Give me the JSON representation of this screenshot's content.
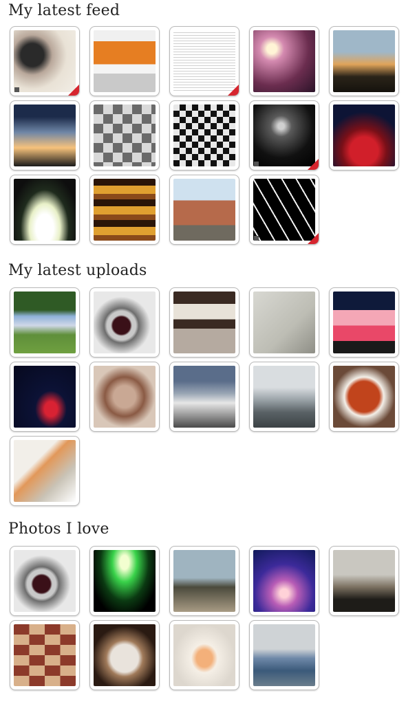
{
  "sections": [
    {
      "title": "My latest feed",
      "photos": [
        {
          "name": "feed-photo-woman-portrait",
          "bg": "radial-gradient(circle at 30% 40%, #2a2a2a 0 20%, #b9a89b 35%, #e9e2d6 60%, #f2eee6 100%)",
          "corner": true,
          "who": true
        },
        {
          "name": "feed-photo-instagram-website",
          "bg": "linear-gradient(180deg,#f0f0f0 0 18%, #e67e22 18% 55%, #f4f4f4 55% 70%, #c9c9c9 70% 100%)",
          "corner": false,
          "who": false
        },
        {
          "name": "feed-photo-article-text",
          "bg": "repeating-linear-gradient(180deg,#ffffff 0 3px,#cfcfcf 3px 4px)",
          "corner": true,
          "who": false
        },
        {
          "name": "feed-photo-sun-through-tree",
          "bg": "radial-gradient(circle at 30% 30%, #fff4d6 0 8%, #d48ab0 20%, #6b2d4f 60%, #2a1328 100%)",
          "corner": false,
          "who": false
        },
        {
          "name": "feed-photo-sunset-trees",
          "bg": "linear-gradient(180deg,#9fb7c8 0 35%, #e0a45a 55%, #2b2419 75%, #15120d 100%)",
          "corner": false,
          "who": false
        },
        {
          "name": "feed-photo-forest-sunset",
          "bg": "linear-gradient(180deg,#1c2b4a 0 20%, #6f86a6 45%, #f6c27b 70%, #1a1a1a 100%)",
          "corner": false,
          "who": false
        },
        {
          "name": "feed-photo-bw-collage",
          "bg": "repeating-conic-gradient(#d9d9d9 0 25%, #6a6a6a 0 50%) 0 0/28px 28px",
          "corner": false,
          "who": false
        },
        {
          "name": "feed-photo-mosaic-grid",
          "bg": "repeating-conic-gradient(#111 0 25%, #e8e8e8 0 50%) 0 0/18px 18px",
          "corner": false,
          "who": false
        },
        {
          "name": "feed-photo-dark-alley",
          "bg": "radial-gradient(circle at 45% 35%, #d0d0d0 0 6%, #5a5a5a 20%, #111 60%, #000 100%)",
          "corner": true,
          "who": true
        },
        {
          "name": "feed-photo-red-chair",
          "bg": "radial-gradient(circle at 50% 75%, #d11f2a 0 25%, #7a1018 40%, #0d1435 70%)",
          "corner": false,
          "who": false
        },
        {
          "name": "feed-photo-umbrella-silhouette",
          "bg": "radial-gradient(ellipse at 50% 80%, #ffffff 0 20%, #e8f0c8 35%, #1f2b1d 55%, #0e0e0e 80%)",
          "corner": false,
          "who": false
        },
        {
          "name": "feed-photo-sandwich-stack",
          "bg": "repeating-linear-gradient(180deg,#2a1508 0 10px,#e0a030 10px 22px,#8a4a1a 22px 30px)",
          "corner": false,
          "who": false
        },
        {
          "name": "feed-photo-ruins-tower",
          "bg": "linear-gradient(180deg,#cfe1ef 0 35%, #b66a4b 35% 75%, #6f6a5f 75% 100%)",
          "corner": false,
          "who": false
        },
        {
          "name": "feed-photo-firework-streaks",
          "bg": "repeating-linear-gradient(60deg,#000 0 8px,#f2f2f2 8px 10px,#000 10px 18px)",
          "corner": true,
          "who": true
        }
      ]
    },
    {
      "title": "My latest uploads",
      "photos": [
        {
          "name": "upload-photo-group-on-lawn",
          "bg": "linear-gradient(180deg,#2f5a25 0 30%, #8fb2d9 40%, #d0d8e8 55%, #5f8f3a 70%, #6fa040 100%)",
          "corner": false,
          "who": false
        },
        {
          "name": "upload-photo-wristwatch",
          "bg": "radial-gradient(circle at 45% 55%, #3a1018 0 18%, #c9c9c9 22% 30%, #6d6d6d 36%, #e8e8e8 60%)",
          "corner": false,
          "who": false
        },
        {
          "name": "upload-photo-machine-counter",
          "bg": "linear-gradient(180deg,#3a2a22 0 20%, #e8e2d8 20% 45%, #3a2a22 45% 60%, #b5aaa0 60% 100%)",
          "corner": false,
          "who": false
        },
        {
          "name": "upload-photo-paper-document",
          "bg": "linear-gradient(135deg,#d8d8d2,#bdbdb4 60%, #8e8e86)",
          "corner": false,
          "who": false
        },
        {
          "name": "upload-photo-pink-gift",
          "bg": "linear-gradient(180deg,#0f1a3a 0 30%, #f4a7b6 30% 55%, #e94868 55% 80%, #1a1a1a 80%)",
          "corner": false,
          "who": false
        },
        {
          "name": "upload-photo-red-shoes",
          "bg": "radial-gradient(ellipse at 60% 70%, #d92233 0 12%, #0c1236 30%, #06091e 100%)",
          "corner": false,
          "who": false
        },
        {
          "name": "upload-photo-cooked-meat",
          "bg": "radial-gradient(circle at 50% 50%, #c9a894 0 25%, #8a5a44 45%, #d9c7b8 70%)",
          "corner": false,
          "who": false
        },
        {
          "name": "upload-photo-metro-station",
          "bg": "linear-gradient(180deg,#5a6d8a 0 25%, #9aa6b5 45%, #e6e6e6 60%, #4a4a4a 100%)",
          "corner": false,
          "who": false
        },
        {
          "name": "upload-photo-city-highway",
          "bg": "linear-gradient(180deg,#d9dde0 0 35%, #9aa3a8 55%, #5a6266 75%, #3c4245 100%)",
          "corner": false,
          "who": false
        },
        {
          "name": "upload-photo-soup-bowl",
          "bg": "radial-gradient(circle at 50% 50%, #c1441c 0 35%, #f3efe8 45%, #6b4a38 70%)",
          "corner": false,
          "who": false
        },
        {
          "name": "upload-photo-man-in-office",
          "bg": "linear-gradient(135deg,#f2efe9 0 35%, #e2985a 45%, #c9c3b6 70%, #ffffff)",
          "corner": false,
          "who": false
        }
      ]
    },
    {
      "title": "Photos I love",
      "photos": [
        {
          "name": "loved-photo-wristwatch",
          "bg": "radial-gradient(circle at 45% 55%, #3a1018 0 18%, #c9c9c9 22% 30%, #6d6d6d 36%, #e8e8e8 60%)",
          "corner": false,
          "who": false
        },
        {
          "name": "loved-photo-green-light",
          "bg": "radial-gradient(ellipse at 50% 20%, #f3ffd0 0 10%, #39d24a 28%, #0b3a12 55%, #000 80%)",
          "corner": false,
          "who": false
        },
        {
          "name": "loved-photo-lone-tree",
          "bg": "linear-gradient(180deg,#9fb4c0 0 45%, #4b4a3c 60%, #a89b84 100%)",
          "corner": false,
          "who": false
        },
        {
          "name": "loved-photo-purple-sky-tree",
          "bg": "radial-gradient(circle at 50% 70%, #ffd2d8 0 8%, #b85db6 25%, #3c2a9a 55%, #101a5a 100%)",
          "corner": false,
          "who": false
        },
        {
          "name": "loved-photo-palm-dusk",
          "bg": "linear-gradient(180deg,#c9c7c0 0 40%, #7b7060 60%, #1e1c18 80%)",
          "corner": false,
          "who": false
        },
        {
          "name": "loved-photo-food-collage",
          "bg": "repeating-conic-gradient(#d8b08a 0 25%, #8c3a2a 0 50%) 0 0/45px 30px",
          "corner": false,
          "who": false
        },
        {
          "name": "loved-photo-plated-dessert",
          "bg": "radial-gradient(circle at 50% 55%, #e9e3dc 0 30%, #a07a5a 40%, #2a1a12 70%)",
          "corner": false,
          "who": false
        },
        {
          "name": "loved-photo-drink-bottle",
          "bg": "radial-gradient(ellipse at 50% 55%, #f3b07a 0 18%, #f5efe6 30%, #ddd7ce 70%)",
          "corner": false,
          "who": false
        },
        {
          "name": "loved-photo-classroom",
          "bg": "linear-gradient(180deg,#cfd3d6 0 40%, #6e88a8 55%, #3b5a7a 75%, #6a7d8c 100%)",
          "corner": false,
          "who": false
        }
      ]
    }
  ]
}
